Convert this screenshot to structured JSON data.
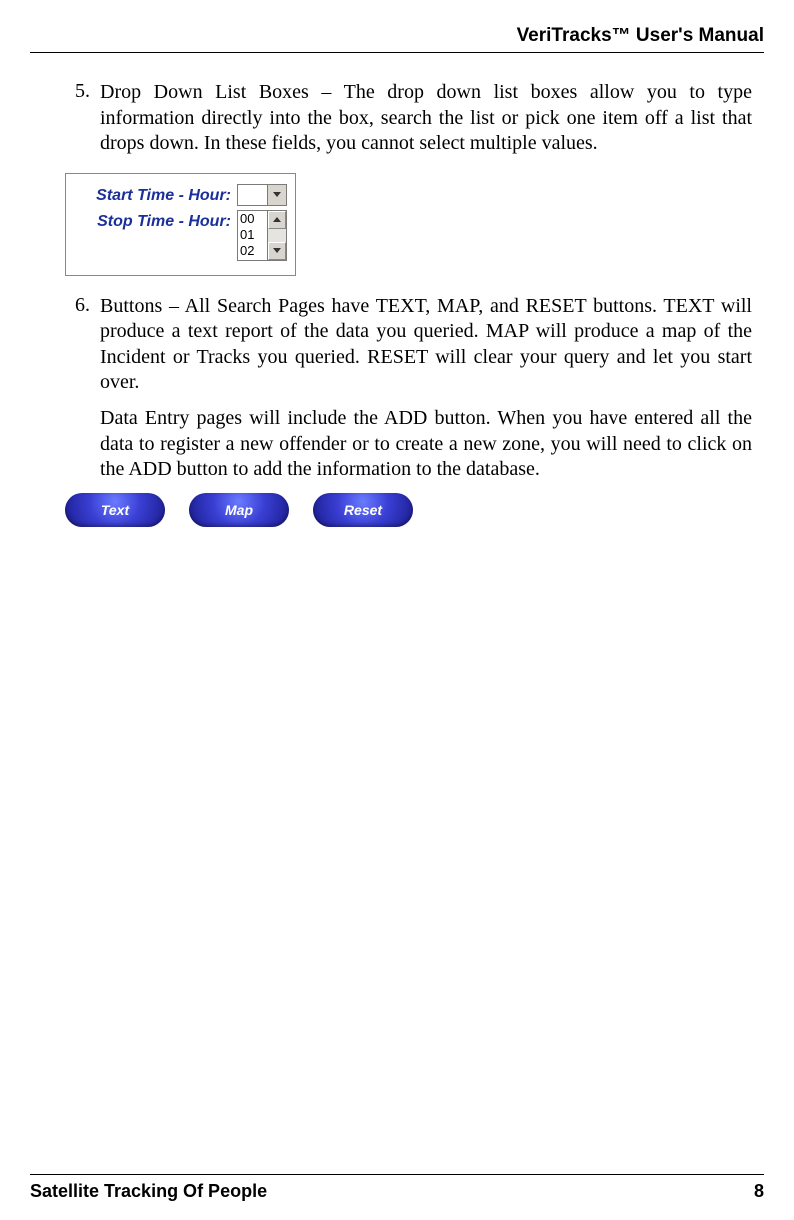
{
  "header": {
    "title": "VeriTracks™ User's Manual"
  },
  "items": [
    {
      "num": "5.",
      "text": "Drop Down List Boxes – The drop down list boxes allow you to type information directly into the box, search the list or pick one item off a list that drops down.  In these fields, you cannot select multiple values."
    },
    {
      "num": "6.",
      "text": "Buttons – All Search Pages have TEXT, MAP, and RESET buttons.  TEXT will produce a text report of the data you queried.  MAP will produce a map of the Incident or Tracks you queried.  RESET will clear your query and let you start over.",
      "text2": "Data Entry pages will include the ADD button.  When you have entered all the data to register a new offender or to create a new zone, you will need to click on the ADD button to add the information to the database."
    }
  ],
  "dropdown_shot": {
    "label1": "Start Time - Hour:",
    "label2": "Stop Time - Hour:",
    "list": [
      "00",
      "01",
      "02"
    ]
  },
  "pill_buttons": [
    "Text",
    "Map",
    "Reset"
  ],
  "footer": {
    "left": "Satellite Tracking Of People",
    "right": "8"
  }
}
